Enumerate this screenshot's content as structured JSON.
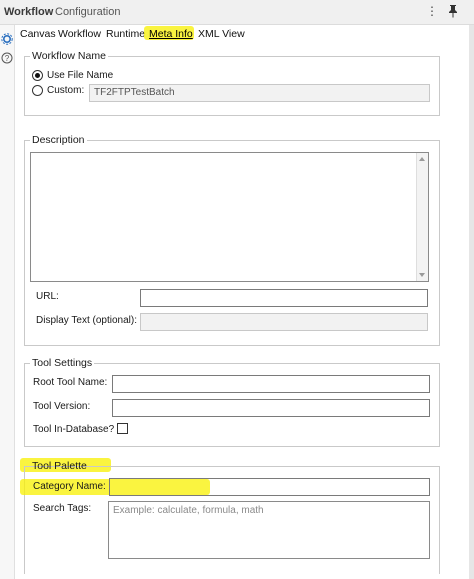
{
  "window": {
    "title_bold": "Workflow",
    "title_separator": "-",
    "title_rest": "Configuration",
    "more_icon": "⋮",
    "pin_icon": "📌"
  },
  "tabs": [
    {
      "label": "Canvas"
    },
    {
      "label": "Workflow"
    },
    {
      "label": "Runtime"
    },
    {
      "label": "Meta Info"
    },
    {
      "label": "XML View"
    }
  ],
  "workflow_name": {
    "legend": "Workflow Name",
    "option_file": "Use File Name",
    "option_custom": "Custom:",
    "custom_value": "TF2FTPTestBatch"
  },
  "description": {
    "legend": "Description",
    "url_label": "URL:",
    "url_value": "",
    "display_text_label": "Display Text (optional):",
    "display_text_value": ""
  },
  "tool_settings": {
    "legend": "Tool Settings",
    "root_tool_name_label": "Root Tool Name:",
    "tool_version_label": "Tool Version:",
    "in_database_label": "Tool In-Database?"
  },
  "tool_palette": {
    "legend": "Tool Palette",
    "category_name_label": "Category Name:",
    "search_tags_label": "Search Tags:",
    "search_tags_placeholder": "Example: calculate, formula, math"
  },
  "colors": {
    "highlight": "#f8f000",
    "active_tab": "#000000"
  }
}
